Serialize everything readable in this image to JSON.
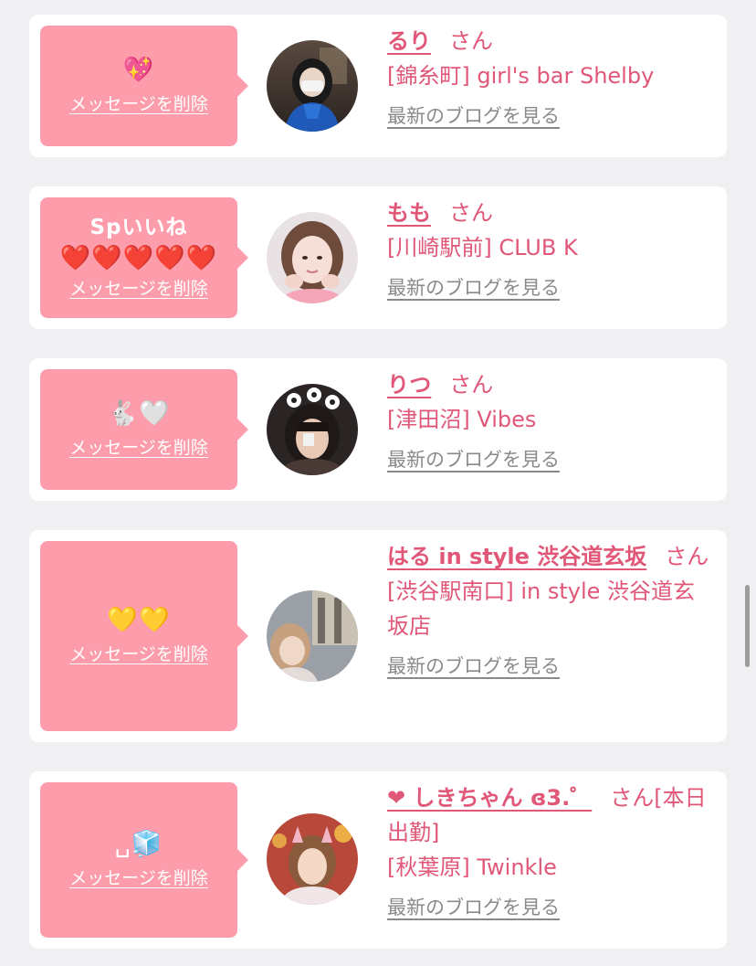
{
  "common": {
    "delete_label": "メッセージを削除",
    "blog_label": "最新のブログを見る",
    "honorific": "さん"
  },
  "colors": {
    "page_background": "#f0f0f2",
    "card_background": "#ffffff",
    "bubble_background": "#fd9dab",
    "accent_pink": "#e05778",
    "link_gray": "#8a8a8a"
  },
  "cards": [
    {
      "bubble_title": "",
      "bubble_emoji": "💖",
      "name": "るり",
      "honorific_suffix": "",
      "shop": "[錦糸町] girl's bar Shelby",
      "avatar_icon": "avatar-photo-icon"
    },
    {
      "bubble_title": "Spいいね",
      "bubble_emoji": "❤️❤️❤️❤️❤️",
      "name": "もも",
      "honorific_suffix": "",
      "shop": "[川崎駅前] CLUB K",
      "avatar_icon": "avatar-photo-icon"
    },
    {
      "bubble_title": "",
      "bubble_emoji": "🐇🤍",
      "name": "りつ",
      "honorific_suffix": "",
      "shop": "[津田沼] Vibes",
      "avatar_icon": "avatar-photo-icon"
    },
    {
      "bubble_title": "",
      "bubble_emoji": "💛💛",
      "name": "はる in style 渋谷道玄坂",
      "honorific_suffix": "",
      "shop": "[渋谷駅南口] in style 渋谷道玄坂店",
      "avatar_icon": "avatar-photo-icon"
    },
    {
      "bubble_title": "",
      "bubble_emoji": "␣🧊",
      "name": "❤ しきちゃん ɞ3.゜",
      "honorific_suffix": "[本日出勤]",
      "shop": "[秋葉原] Twinkle",
      "avatar_icon": "avatar-photo-icon"
    }
  ]
}
